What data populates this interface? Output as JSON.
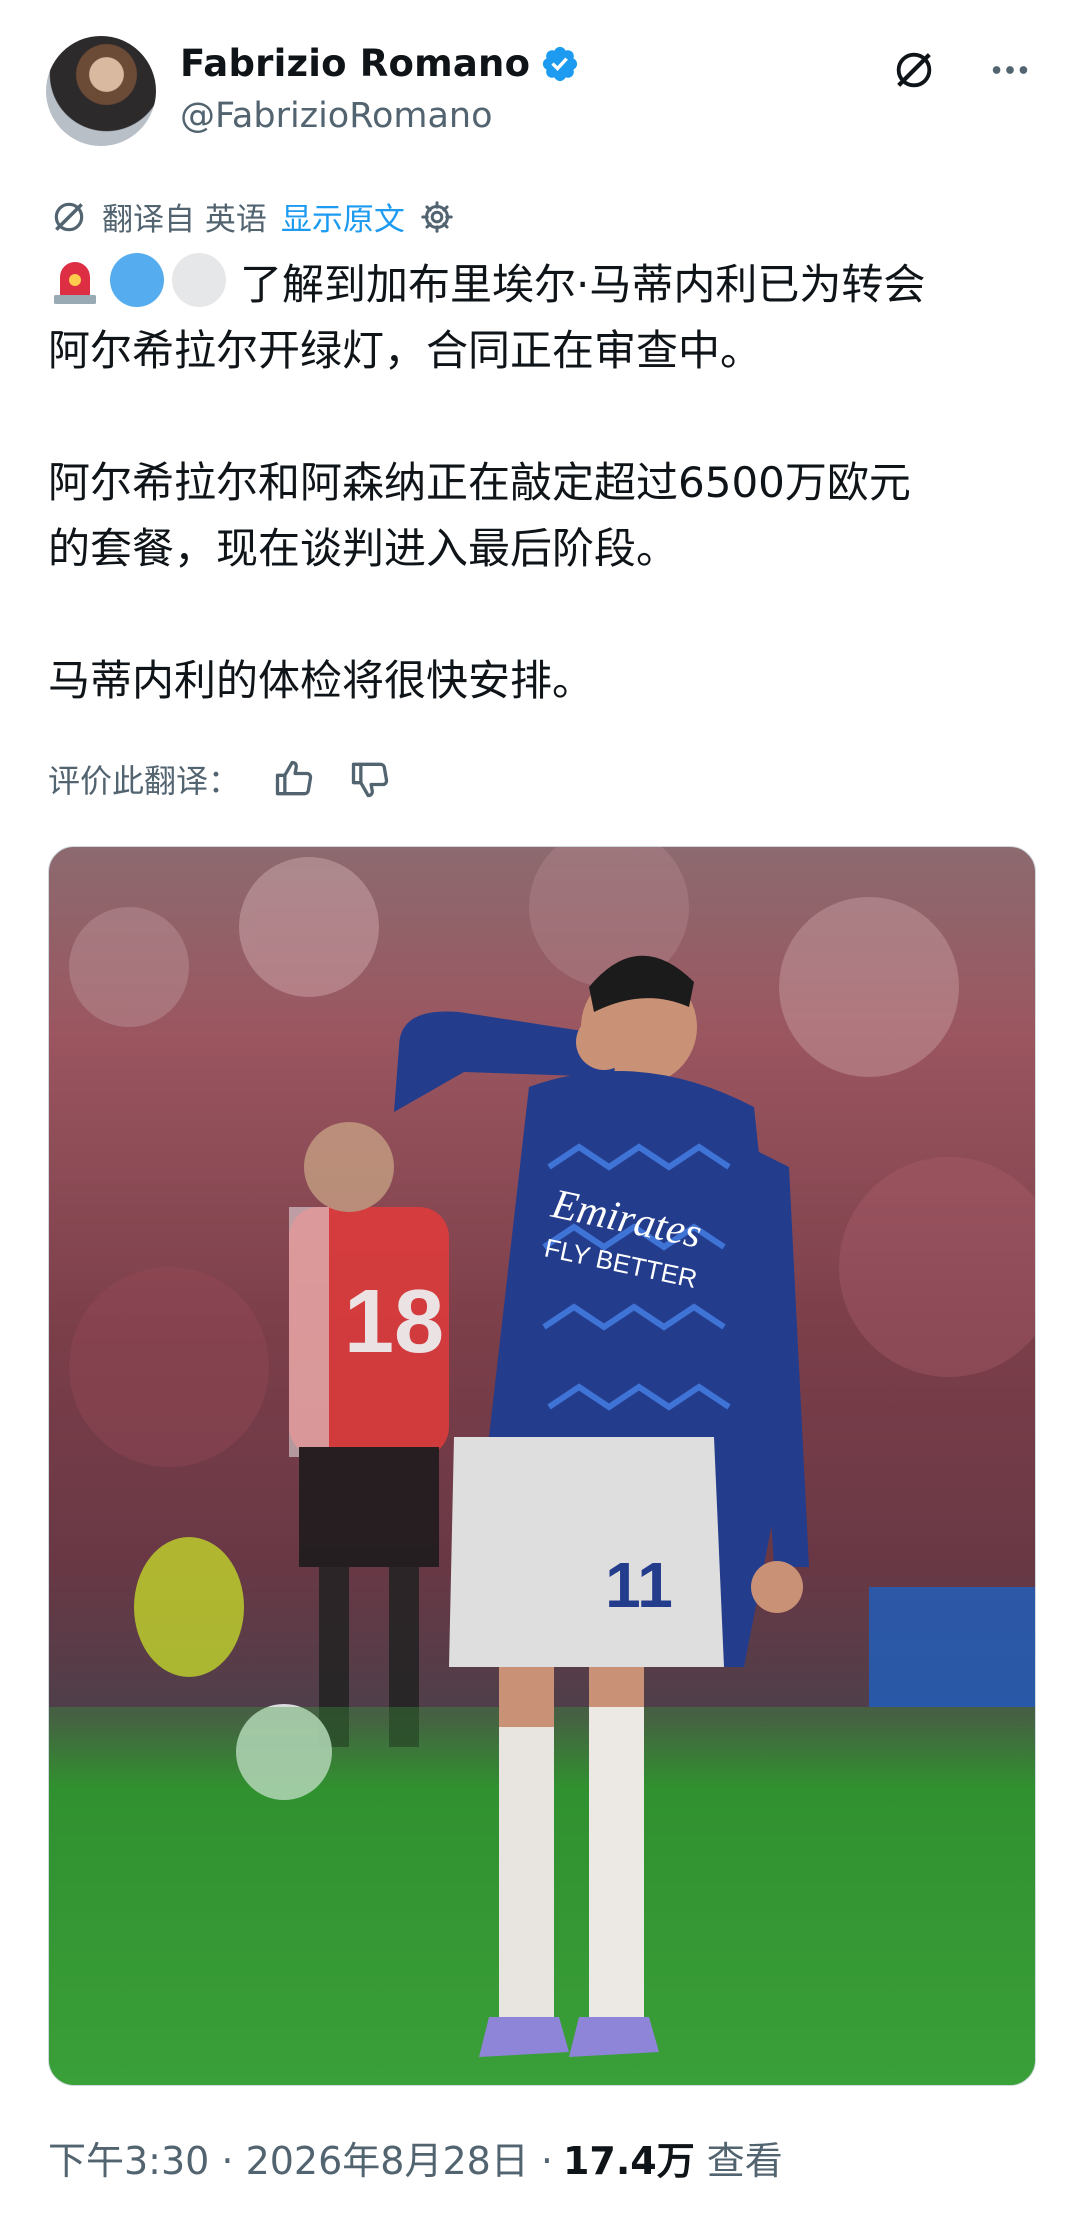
{
  "header": {
    "display_name": "Fabrizio Romano",
    "handle": "@FabrizioRomano",
    "verified_icon": "verified-badge-icon",
    "grok_icon": "grok-icon",
    "more_icon": "more-dots-icon"
  },
  "translation": {
    "translated_from": "翻译自 英语",
    "show_original": "显示原文",
    "settings_icon": "gear-icon"
  },
  "tweet": {
    "line1": "了解到加布里埃尔·马蒂内利已为转会",
    "line2": "阿尔希拉尔开绿灯，合同正在审查中。",
    "para2": "阿尔希拉尔和阿森纳正在敲定超过6500万欧元\n的套餐，现在谈判进入最后阶段。",
    "para3": "马蒂内利的体检将很快安排。",
    "emojis": [
      "siren-emoji",
      "blue-circle-emoji",
      "white-circle-emoji"
    ]
  },
  "rating": {
    "label": "评价此翻译："
  },
  "photo": {
    "jersey_text_1": "Emirates",
    "jersey_text_2": "FLY BETTER",
    "shorts_number": "11",
    "background_player_number": "18"
  },
  "footer": {
    "time": "下午3:30 · 2026年8月28日 · ",
    "views": "17.4万",
    "views_label": "查看"
  },
  "colors": {
    "accent": "#1d9bf0",
    "text": "#0f1419",
    "secondary": "#536471"
  }
}
